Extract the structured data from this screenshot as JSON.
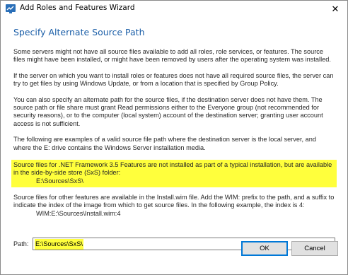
{
  "window": {
    "title": "Add Roles and Features Wizard",
    "close_glyph": "✕"
  },
  "heading": "Specify Alternate Source Path",
  "paragraphs": {
    "p1": "Some servers might not have all source files available to add all roles, role services, or features. The source files might have been installed, or might have been removed by users after the operating system was installed.",
    "p2": "If the server on which you want to install roles or features does not have all required source files, the server can try to get files by using Windows Update, or from a location that is specified by Group Policy.",
    "p3": "You can also specify an alternate path for the source files, if the destination server does not have them. The source path or file share must grant Read permissions either to the Everyone group (not recommended for security reasons), or to the computer (local system) account of the destination server; granting user account access is not sufficient.",
    "p4": "The following are examples of a valid source file path where the destination server is the local server, and where the E: drive contains the Windows Server installation media.",
    "p5": "Source files for .NET Framework 3.5 Features are not installed as part of a typical installation, but are available in the side-by-side store (SxS) folder:",
    "p5_example": "E:\\Sources\\SxS\\",
    "p6": "Source files for other features are available in the Install.wim file. Add the WIM: prefix to the path, and a suffix to indicate the index of the image from which to get source files. In the following example, the index is 4:",
    "p6_example": "WIM:E:\\Sources\\Install.wim:4"
  },
  "path": {
    "label": "Path:",
    "value": "E:\\Sources\\SxS\\"
  },
  "buttons": {
    "ok": "OK",
    "cancel": "Cancel"
  },
  "colors": {
    "heading": "#1c5fa8",
    "highlight": "#ffff3c",
    "ok_border": "#0078d7"
  },
  "icons": {
    "app": "server-manager-icon",
    "close": "close-icon"
  }
}
